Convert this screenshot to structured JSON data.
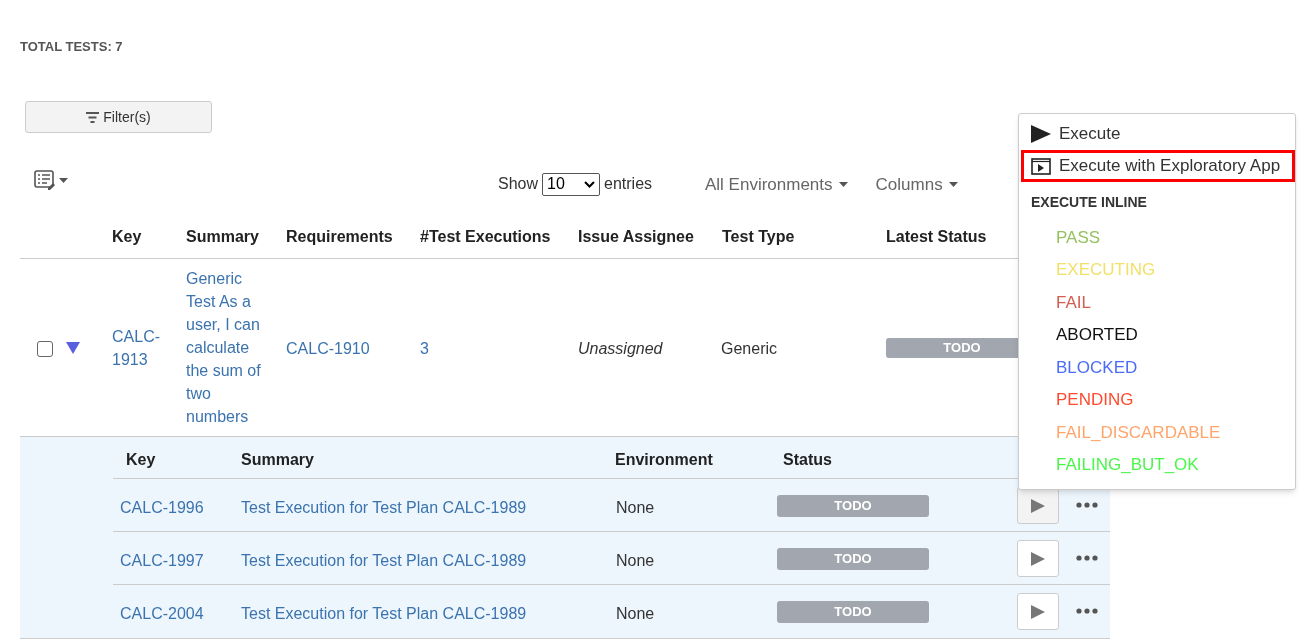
{
  "total_tests": "TOTAL TESTS: 7",
  "filter_button": "Filter(s)",
  "page_size": {
    "label_before": "Show",
    "value": "10",
    "label_after": "entries"
  },
  "toolbar_dropdowns": [
    "All Environments",
    "Columns"
  ],
  "table": {
    "columns": [
      "Key",
      "Summary",
      "Requirements",
      "#Test Executions",
      "Issue Assignee",
      "Test Type",
      "Latest Status"
    ],
    "rows": [
      {
        "checked": false,
        "expanded": true,
        "key": "CALC-1913",
        "summary": "Generic Test As a user, I can calculate the sum of two numbers",
        "requirements": "CALC-1910",
        "test_executions": "3",
        "assignee": "Unassigned",
        "test_type": "Generic",
        "latest_status": "TODO",
        "executions": {
          "columns": [
            "Key",
            "Summary",
            "Environment",
            "Status"
          ],
          "rows": [
            {
              "key": "CALC-1996",
              "summary": "Test Execution for Test Plan CALC-1989",
              "environment": "None",
              "status": "TODO",
              "run_hovered": true
            },
            {
              "key": "CALC-1997",
              "summary": "Test Execution for Test Plan CALC-1989",
              "environment": "None",
              "status": "TODO",
              "run_hovered": false
            },
            {
              "key": "CALC-2004",
              "summary": "Test Execution for Test Plan CALC-1989",
              "environment": "None",
              "status": "TODO",
              "run_hovered": false
            }
          ]
        }
      }
    ]
  },
  "run_menu": {
    "items": [
      {
        "kind": "execute",
        "label": "Execute",
        "highlighted": false
      },
      {
        "kind": "exploratory",
        "label": "Execute with Exploratory App",
        "highlighted": true
      }
    ],
    "section_title": "EXECUTE INLINE",
    "statuses": [
      {
        "label": "PASS",
        "color": "#95c160"
      },
      {
        "label": "EXECUTING",
        "color": "#f1e069"
      },
      {
        "label": "FAIL",
        "color": "#d45d52"
      },
      {
        "label": "ABORTED",
        "color": "#111111"
      },
      {
        "label": "BLOCKED",
        "color": "#4a6cf7"
      },
      {
        "label": "PENDING",
        "color": "#ff4a2f"
      },
      {
        "label": "FAIL_DISCARDABLE",
        "color": "#ffa56b"
      },
      {
        "label": "FAILING_BUT_OK",
        "color": "#4bf64b"
      }
    ]
  }
}
